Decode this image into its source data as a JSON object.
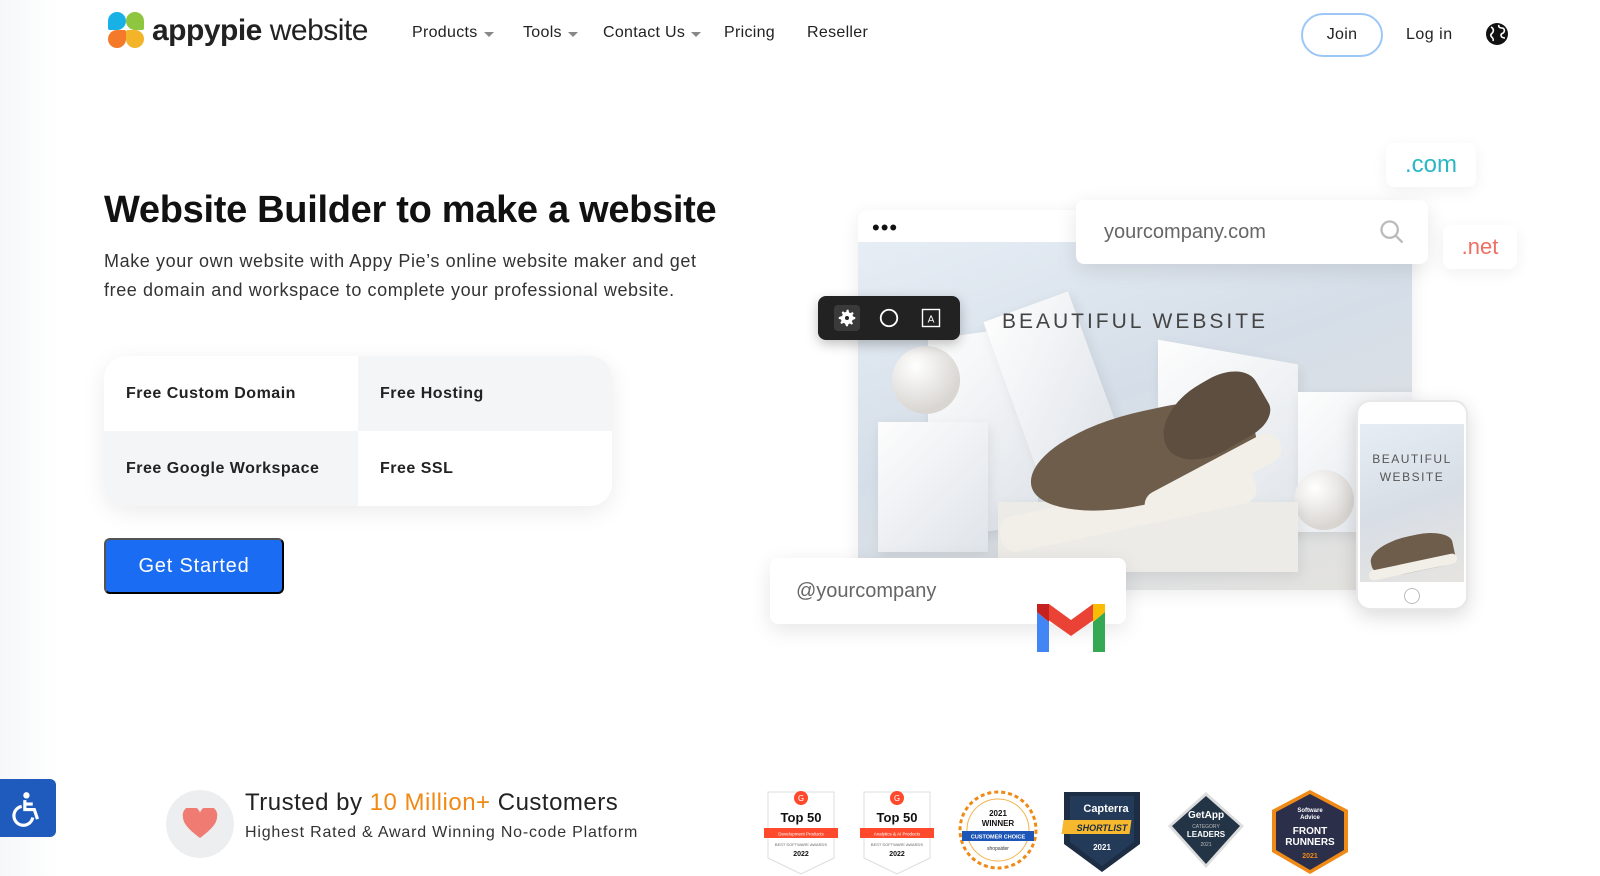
{
  "header": {
    "logo_brand": "appypie",
    "logo_product": "website",
    "nav": [
      {
        "label": "Products",
        "dropdown": true
      },
      {
        "label": "Tools",
        "dropdown": true
      },
      {
        "label": "Contact Us",
        "dropdown": true
      },
      {
        "label": "Pricing",
        "dropdown": false
      },
      {
        "label": "Reseller",
        "dropdown": false
      }
    ],
    "join_label": "Join",
    "login_label": "Log in",
    "language_icon": "globe-icon"
  },
  "hero": {
    "title": "Website Builder to make a website",
    "description": "Make your own website with Appy Pie’s online website maker and get free domain and workspace to complete your professional website.",
    "features": [
      "Free Custom Domain",
      "Free Hosting",
      "Free Google Workspace",
      "Free SSL"
    ],
    "cta_label": "Get Started"
  },
  "illustration": {
    "browser_dots": "•••",
    "banner_text": "BEAUTIFUL WEBSITE",
    "domain_search": "yourcompany.com",
    "tld_com": ".com",
    "tld_net": ".net",
    "phone_label_line1": "BEAUTIFUL",
    "phone_label_line2": "WEBSITE",
    "email_handle": "@yourcompany",
    "toolbar_icons": [
      "gear-icon",
      "circle-icon",
      "text-icon"
    ]
  },
  "trust": {
    "title_prefix": "Trusted by ",
    "title_highlight": "10 Million+",
    "title_suffix": " Customers",
    "subtitle": "Highest Rated & Award Winning No-code Platform",
    "highlight_color": "#f08a16",
    "badges": [
      {
        "name": "g2-top50-dev",
        "line1": "Top 50",
        "line2": "Development Products",
        "line3": "BEST SOFTWARE AWARDS",
        "year": "2022"
      },
      {
        "name": "g2-top50-analytics",
        "line1": "Top 50",
        "line2": "Analytics & AI Products",
        "line3": "BEST SOFTWARE AWARDS",
        "year": "2022"
      },
      {
        "name": "softwaresuggest-winner",
        "year": "2021",
        "line1": "WINNER",
        "line2": "CUSTOMER CHOICE",
        "line3": "shopaider"
      },
      {
        "name": "capterra-shortlist",
        "line1": "Capterra",
        "line2": "SHORTLIST",
        "year": "2021"
      },
      {
        "name": "getapp-leaders",
        "line1": "GetApp",
        "line2": "CATEGORY",
        "line3": "LEADERS",
        "year": "2021"
      },
      {
        "name": "software-advice-frontrunners",
        "line1": "Software",
        "line2": "Advice",
        "line3": "FRONT",
        "line4": "RUNNERS",
        "year": "2021"
      }
    ]
  },
  "accessibility": {
    "icon": "wheelchair-icon"
  },
  "colors": {
    "primary": "#1a6cf2",
    "com": "#2cb6c4",
    "net": "#ef6e62"
  }
}
